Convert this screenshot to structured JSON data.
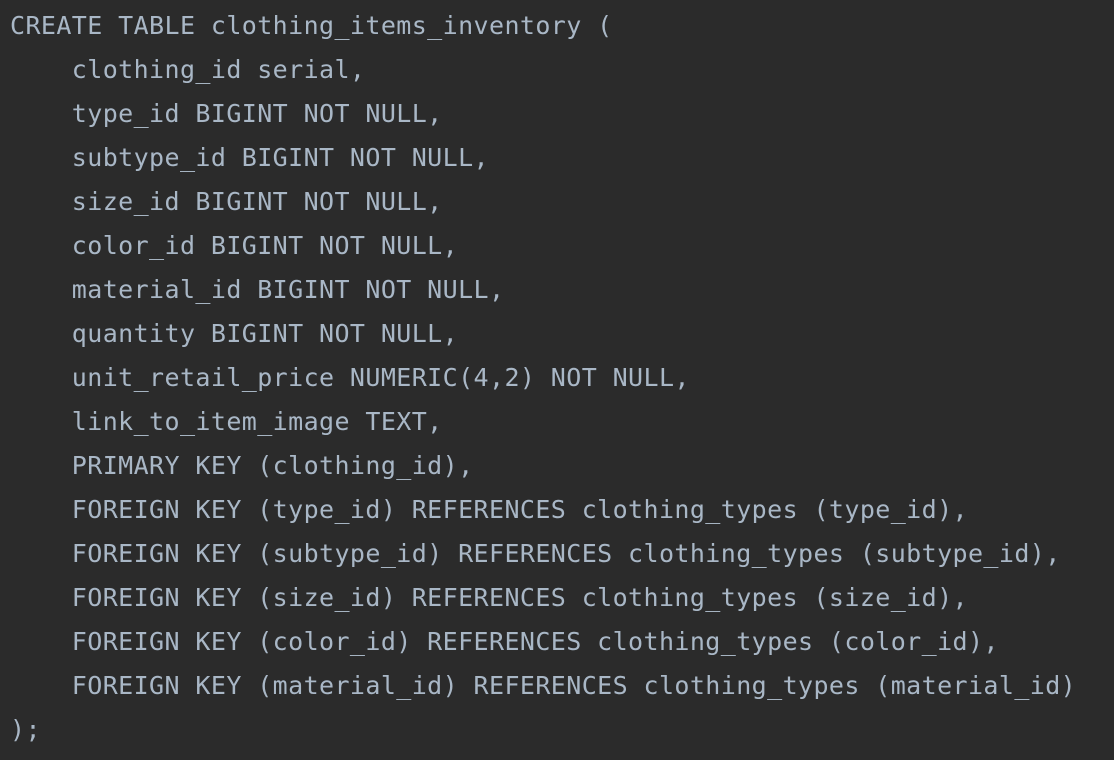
{
  "editor": {
    "lines": [
      "CREATE TABLE clothing_items_inventory (",
      "    clothing_id serial,",
      "    type_id BIGINT NOT NULL,",
      "    subtype_id BIGINT NOT NULL,",
      "    size_id BIGINT NOT NULL,",
      "    color_id BIGINT NOT NULL,",
      "    material_id BIGINT NOT NULL,",
      "    quantity BIGINT NOT NULL,",
      "    unit_retail_price NUMERIC(4,2) NOT NULL,",
      "    link_to_item_image TEXT,",
      "    PRIMARY KEY (clothing_id),",
      "    FOREIGN KEY (type_id) REFERENCES clothing_types (type_id),",
      "    FOREIGN KEY (subtype_id) REFERENCES clothing_types (subtype_id),",
      "    FOREIGN KEY (size_id) REFERENCES clothing_types (size_id),",
      "    FOREIGN KEY (color_id) REFERENCES clothing_types (color_id),",
      "    FOREIGN KEY (material_id) REFERENCES clothing_types (material_id)",
      ");"
    ]
  },
  "colors": {
    "background": "#2b2b2b",
    "text": "#a9b7c6"
  }
}
